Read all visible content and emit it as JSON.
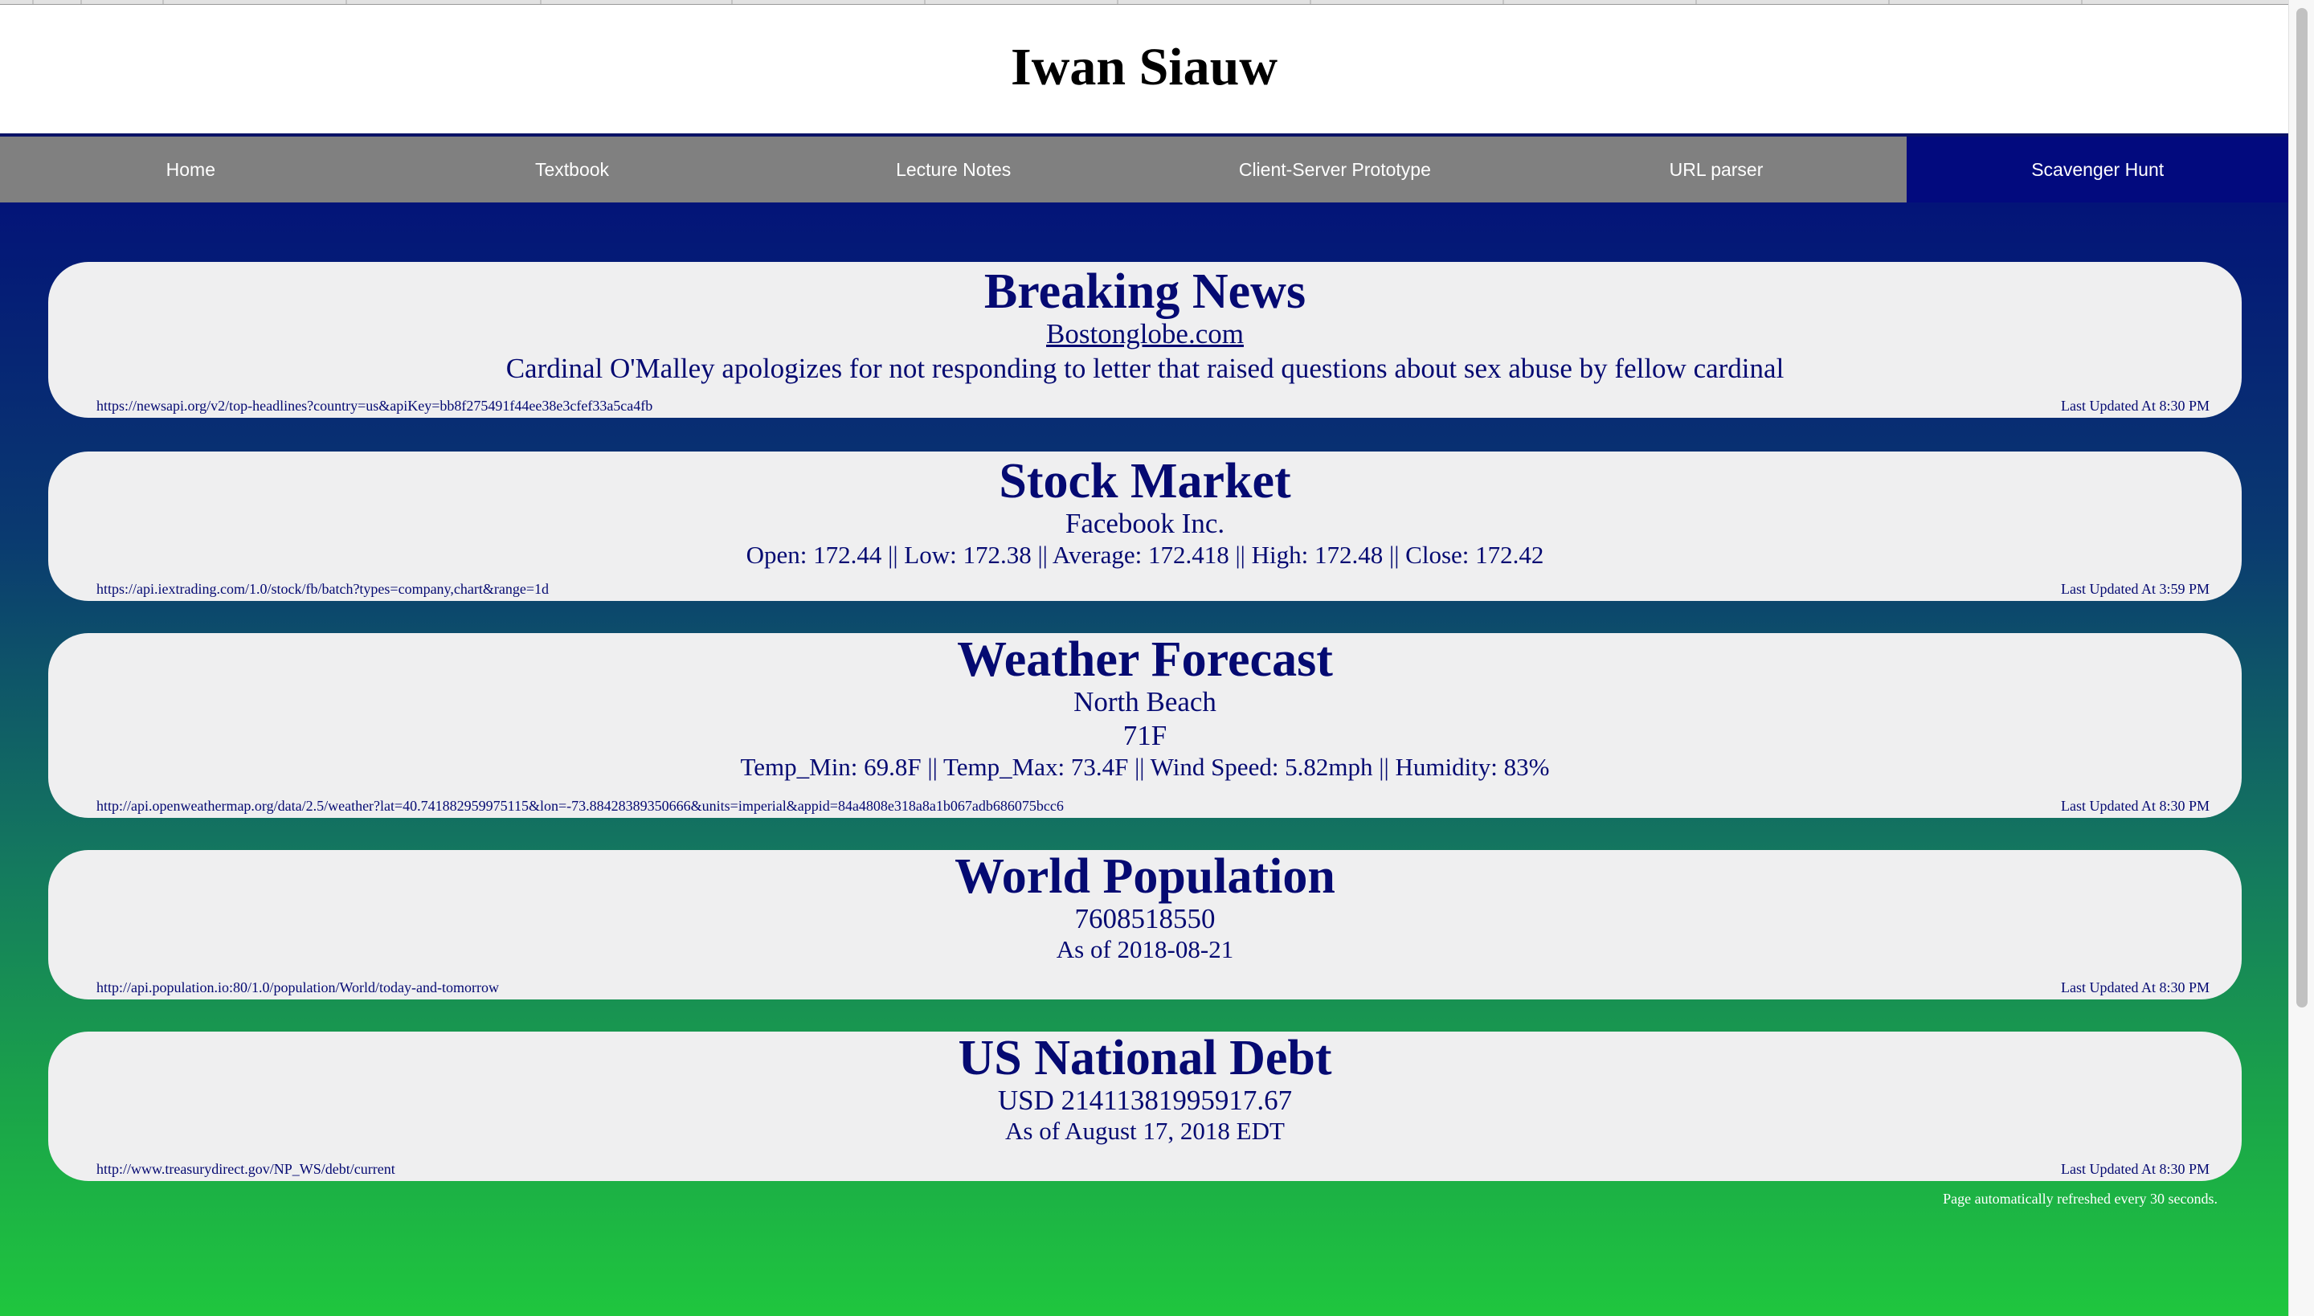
{
  "site": {
    "title": "Iwan Siauw"
  },
  "nav": {
    "items": [
      {
        "label": "Home"
      },
      {
        "label": "Textbook"
      },
      {
        "label": "Lecture Notes"
      },
      {
        "label": "Client-Server Prototype"
      },
      {
        "label": "URL parser"
      },
      {
        "label": "Scavenger Hunt",
        "active": true
      }
    ]
  },
  "colors": {
    "card_text": "#050a72",
    "nav_bg": "#808080",
    "nav_active_bg": "#020a7e",
    "gradient_top": "#031478",
    "gradient_bottom": "#1fc63e",
    "card_bg": "#efeff0"
  },
  "cards": {
    "news": {
      "title": "Breaking News",
      "source_name": "Bostonglobe.com",
      "headline": "Cardinal O'Malley apologizes for not responding to letter that raised questions about sex abuse by fellow cardinal",
      "api_url": "https://newsapi.org/v2/top-headlines?country=us&apiKey=bb8f275491f44ee38e3cfef33a5ca4fb",
      "updated": "Last Updated At 8:30 PM"
    },
    "stock": {
      "title": "Stock Market",
      "company": "Facebook Inc.",
      "summary": "Open: 172.44 || Low: 172.38 || Average: 172.418 || High: 172.48 || Close: 172.42",
      "api_url": "https://api.iextrading.com/1.0/stock/fb/batch?types=company,chart&range=1d",
      "updated": "Last Updated At 3:59 PM"
    },
    "weather": {
      "title": "Weather Forecast",
      "location": "North Beach",
      "temp": "71F",
      "details": "Temp_Min: 69.8F || Temp_Max: 73.4F || Wind Speed: 5.82mph || Humidity: 83%",
      "api_url": "http://api.openweathermap.org/data/2.5/weather?lat=40.741882959975115&lon=-73.88428389350666&units=imperial&appid=84a4808e318a8a1b067adb686075bcc6",
      "updated": "Last Updated At 8:30 PM"
    },
    "population": {
      "title": "World Population",
      "value": "7608518550",
      "as_of": "As of 2018-08-21",
      "api_url": "http://api.population.io:80/1.0/population/World/today-and-tomorrow",
      "updated": "Last Updated At 8:30 PM"
    },
    "debt": {
      "title": "US National Debt",
      "value": "USD 21411381995917.67",
      "as_of": "As of August 17, 2018 EDT",
      "api_url": "http://www.treasurydirect.gov/NP_WS/debt/current",
      "updated": "Last Updated At 8:30 PM"
    }
  },
  "footer": {
    "refresh_note": "Page automatically refreshed every 30 seconds."
  }
}
